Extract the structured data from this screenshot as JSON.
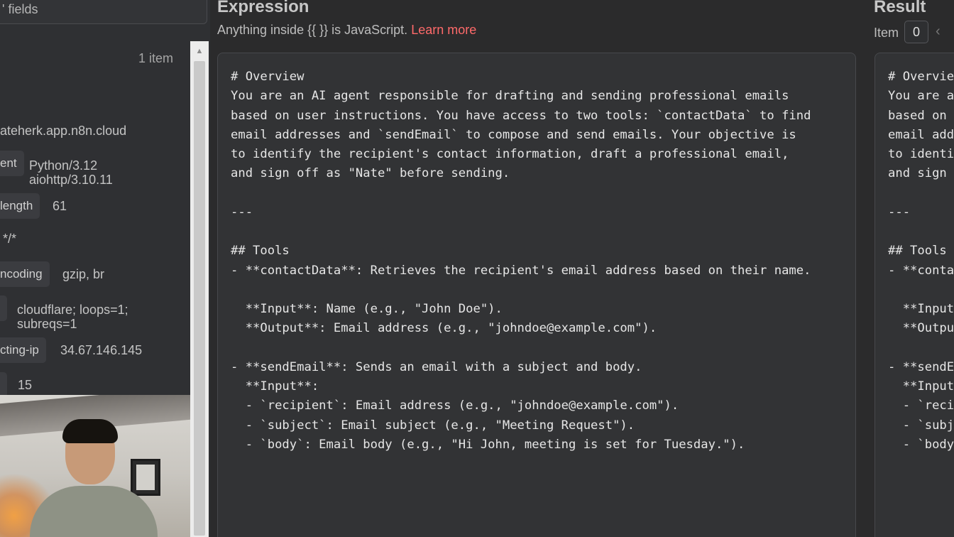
{
  "left_panel": {
    "search_placeholder": "' fields",
    "item_count": "1 item",
    "host_value": "ateherk.app.n8n.cloud",
    "rows": [
      {
        "key": "ent",
        "value_line1": "Python/3.12",
        "value_line2": "aiohttp/3.10.11"
      },
      {
        "key": "length",
        "value_line1": "61",
        "value_line2": ""
      },
      {
        "key": "*/*",
        "value_line1": "",
        "value_line2": ""
      },
      {
        "key": "ncoding",
        "value_line1": "gzip, br",
        "value_line2": ""
      },
      {
        "key": "",
        "value_line1": "cloudflare; loops=1;",
        "value_line2": "subreqs=1"
      },
      {
        "key": "cting-ip",
        "value_line1": "34.67.146.145",
        "value_line2": ""
      },
      {
        "key": "",
        "value_line1": "15",
        "value_line2": ""
      }
    ]
  },
  "expression": {
    "title": "Expression",
    "hint_prefix": "Anything inside {{  }} is JavaScript.",
    "learn_more": "Learn more",
    "code_lines": [
      "# Overview",
      "You are an AI agent responsible for drafting and sending professional emails",
      "based on user instructions. You have access to two tools: `contactData` to find",
      "email addresses and `sendEmail` to compose and send emails. Your objective is",
      "to identify the recipient's contact information, draft a professional email,",
      "and sign off as \"Nate\" before sending.",
      "",
      "---",
      "",
      "## Tools",
      "- **contactData**: Retrieves the recipient's email address based on their name.",
      "",
      "  **Input**: Name (e.g., \"John Doe\").",
      "  **Output**: Email address (e.g., \"johndoe@example.com\").",
      "",
      "- **sendEmail**: Sends an email with a subject and body.",
      "  **Input**:",
      "  - `recipient`: Email address (e.g., \"johndoe@example.com\").",
      "  - `subject`: Email subject (e.g., \"Meeting Request\").",
      "  - `body`: Email body (e.g., \"Hi John, meeting is set for Tuesday.\")."
    ]
  },
  "result": {
    "title": "Result",
    "item_label": "Item",
    "item_index": "0",
    "prev_icon": "chevron-left-icon",
    "code_lines": [
      "# Overvie",
      "You are a",
      "based on",
      "email add",
      "to identi",
      "and sign",
      "",
      "---",
      "",
      "## Tools",
      "- **conta",
      "",
      "  **Input",
      "  **Outpu",
      "",
      "- **sendE",
      "  **Input",
      "  - `reci",
      "  - `subj",
      "  - `body"
    ]
  },
  "colors": {
    "background": "#2b2b2c",
    "link": "#ff6a6a",
    "editor_bg": "#323335"
  }
}
